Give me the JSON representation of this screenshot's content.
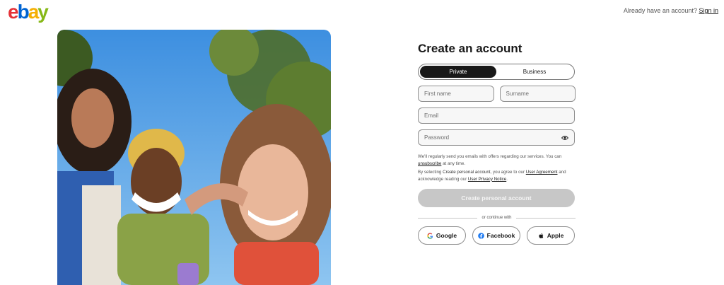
{
  "header": {
    "logo": {
      "e": "e",
      "b": "b",
      "a": "a",
      "y": "y",
      "colors": [
        "#e53238",
        "#0064d2",
        "#f5af02",
        "#86b817"
      ]
    },
    "signin_prompt": "Already have an account?",
    "signin_link": "Sign in"
  },
  "hero": {
    "image": "three-friends-selfie-photo"
  },
  "form": {
    "title": "Create an account",
    "account_types": {
      "private": "Private",
      "business": "Business",
      "selected": "Private"
    },
    "first_name_placeholder": "First name",
    "surname_placeholder": "Surname",
    "email_placeholder": "Email",
    "password_placeholder": "Password",
    "password_icon": "eye-icon",
    "notice1_text": "We'll regularly send you emails with offers regarding our services. You can",
    "notice1_link": "unsubscribe",
    "notice1_tail": "at any time.",
    "notice2_text": "By selecting",
    "notice2_strong": "Create personal account",
    "notice2_mid": ", you agree to our",
    "notice2_link1": "User Agreement",
    "notice2_mid2": "and acknowledge reading our",
    "notice2_link2": "User Privacy Notice",
    "notice2_end": ".",
    "create_button": "Create personal account",
    "divider_text": "or continue with",
    "social": {
      "google": "Google",
      "facebook": "Facebook",
      "apple": "Apple"
    }
  },
  "colors": {
    "accent_dark": "#191919",
    "button_disabled": "#c7c7c7",
    "link": "#191919"
  }
}
